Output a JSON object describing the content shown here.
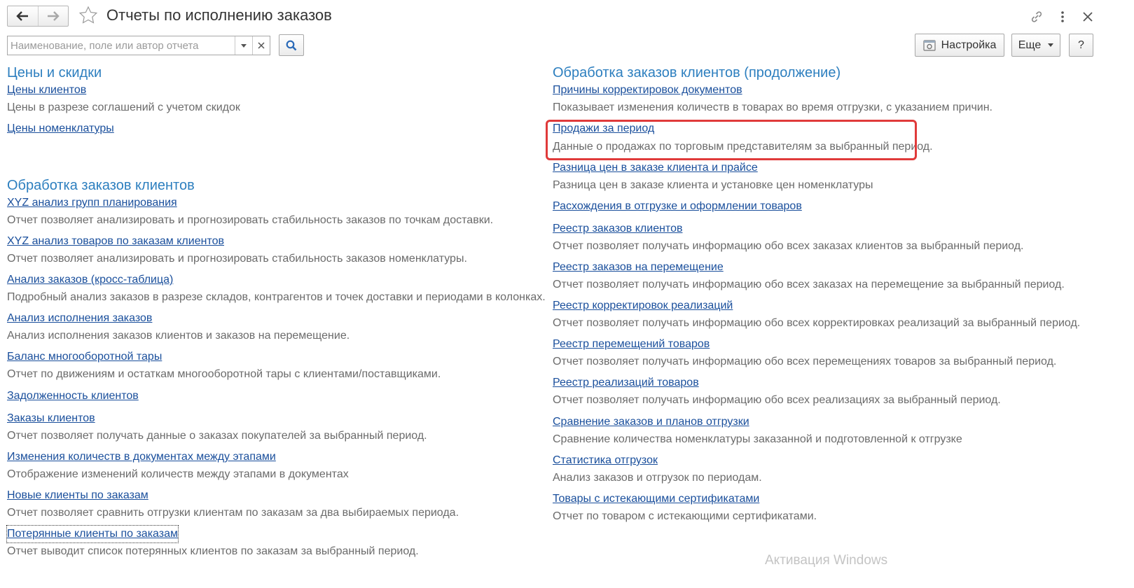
{
  "window": {
    "title": "Отчеты по исполнению заказов"
  },
  "toolbar": {
    "search_placeholder": "Наименование, поле или автор отчета",
    "settings_label": "Настройка",
    "more_label": "Еще",
    "help_label": "?"
  },
  "left_column": {
    "sections": [
      {
        "title": "Цены и скидки",
        "items": [
          {
            "link": "Цены клиентов",
            "desc": "Цены в разрезе соглашений с учетом скидок"
          },
          {
            "link": "Цены номенклатуры",
            "desc": ""
          }
        ]
      },
      {
        "title": "Обработка заказов клиентов",
        "items": [
          {
            "link": "XYZ анализ групп планирования",
            "desc": "Отчет позволяет анализировать и прогнозировать стабильность заказов по точкам доставки."
          },
          {
            "link": "XYZ анализ товаров по заказам клиентов",
            "desc": "Отчет позволяет анализировать и прогнозировать стабильность заказов номенклатуры."
          },
          {
            "link": "Анализ заказов (кросс-таблица)",
            "desc": "Подробный анализ заказов в разрезе складов, контрагентов и точек доставки и периодами в колонках."
          },
          {
            "link": "Анализ исполнения заказов",
            "desc": "Анализ исполнения заказов клиентов и заказов на перемещение."
          },
          {
            "link": "Баланс многооборотной тары",
            "desc": "Отчет по движениям и остаткам многооборотной тары с клиентами/поставщиками."
          },
          {
            "link": "Задолженность клиентов",
            "desc": ""
          },
          {
            "link": "Заказы клиентов",
            "desc": "Отчет позволяет получать данные о заказах покупателей за выбранный период."
          },
          {
            "link": "Изменения количеств в документах между этапами",
            "desc": "Отображение изменений количеств между этапами в документах"
          },
          {
            "link": "Новые клиенты по заказам",
            "desc": "Отчет позволяет сравнить отгрузки клиентам по заказам за два выбираемых периода."
          },
          {
            "link": "Потерянные клиенты по заказам",
            "desc": "Отчет выводит список потерянных клиентов по заказам за выбранный период."
          }
        ]
      }
    ]
  },
  "right_column": {
    "title": "Обработка заказов клиентов (продолжение)",
    "items": [
      {
        "link": "Причины корректировок документов",
        "desc": "Показывает изменения количеств в товарах во время отгрузки, с указанием причин."
      },
      {
        "link": "Продажи за период",
        "desc": "Данные о продажах по торговым представителям за выбранный период."
      },
      {
        "link": "Разница цен в заказе клиента и прайсе",
        "desc": "Разница цен в заказе клиента и установке цен номенклатуры"
      },
      {
        "link": "Расхождения в отгрузке и оформлении товаров",
        "desc": ""
      },
      {
        "link": "Реестр заказов клиентов",
        "desc": "Отчет позволяет получать информацию обо всех заказах клиентов за выбранный период."
      },
      {
        "link": "Реестр заказов на перемещение",
        "desc": "Отчет позволяет получать информацию обо всех заказах на перемещение за выбранный период."
      },
      {
        "link": "Реестр корректировок реализаций",
        "desc": "Отчет позволяет получать информацию обо всех корректировках реализаций за выбранный период."
      },
      {
        "link": "Реестр перемещений товаров",
        "desc": "Отчет позволяет получать информацию обо всех перемещениях товаров за выбранный период."
      },
      {
        "link": "Реестр реализаций товаров",
        "desc": "Отчет позволяет получать информацию обо всех реализациях за выбранный период."
      },
      {
        "link": "Сравнение заказов и планов отгрузки",
        "desc": "Сравнение количества номенклатуры заказанной и подготовленной к отгрузке"
      },
      {
        "link": "Статистика отгрузок",
        "desc": "Анализ заказов и отгрузок по периодам."
      },
      {
        "link": "Товары с истекающими сертификатами",
        "desc": "Отчет по товаром с истекающими сертификатами."
      }
    ]
  },
  "watermark": "Активация Windows",
  "colors": {
    "link": "#1a4f9c",
    "section_title": "#2d7fbf",
    "description": "#6b6b6b",
    "highlight": "#e03a3a"
  }
}
